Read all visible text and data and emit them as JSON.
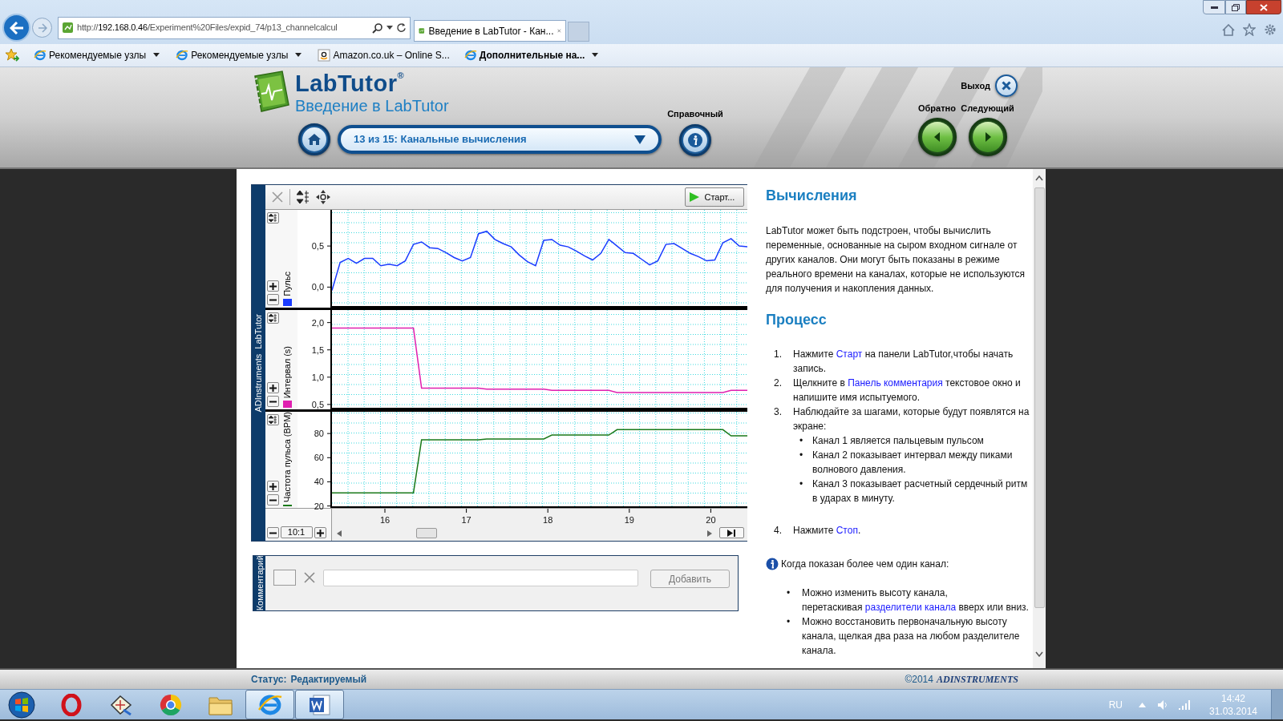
{
  "browser": {
    "address": {
      "scheme": "http://",
      "host": "192.168.0.46",
      "path": "/Experiment%20Files/expid_74/p13_channelcalcul"
    },
    "tab": "Введение в LabTutor - Кан...",
    "favorites": [
      {
        "kind": "ie",
        "label": "Рекомендуемые узлы",
        "emphasized": false,
        "menu": true
      },
      {
        "kind": "ie",
        "label": "Рекомендуемые узлы",
        "emphasized": false,
        "menu": true
      },
      {
        "kind": "amazon",
        "label": "Amazon.co.uk – Online S...",
        "emphasized": false,
        "menu": false
      },
      {
        "kind": "ie",
        "label": "Дополнительные на...",
        "emphasized": true,
        "menu": true
      }
    ]
  },
  "header": {
    "logo": "LabTutor$^{®}$",
    "subtitle": "Введение в LabTutor",
    "page_select": "13 из 15: Канальные вычисления",
    "help_label": "Справочный",
    "exit_label": "Выход",
    "back_label": "Обратно",
    "next_label": "Следующий"
  },
  "chart_panel": {
    "side_label": "ADInstruments  LabTutor",
    "start_button": "Старт...",
    "zoom_ratio": "10:1",
    "channels": [
      {
        "chart_data": {
          "type": "line",
          "grid": true,
          "ylabel": "Пульс",
          "categories": [
            null,
            null,
            null,
            null,
            null,
            null,
            null,
            null,
            null,
            null,
            null,
            null,
            null,
            null,
            null,
            null,
            null,
            null,
            null,
            null,
            null,
            null,
            null,
            null,
            null,
            null,
            null,
            null,
            null,
            null,
            null,
            null,
            null,
            null,
            null,
            null,
            null,
            null,
            null,
            null,
            null,
            null,
            null,
            null,
            null,
            null,
            null,
            null,
            null,
            null,
            null,
            null
          ],
          "series": [
            {
              "color": "#1a3cff",
              "values": [
                -0.04,
                0.3,
                0.35,
                0.29,
                0.35,
                0.35,
                0.26,
                0.28,
                0.26,
                0.32,
                0.52,
                0.55,
                0.48,
                0.47,
                0.42,
                0.36,
                0.32,
                0.36,
                0.65,
                0.68,
                0.58,
                0.53,
                0.49,
                0.39,
                0.31,
                0.26,
                0.57,
                0.58,
                0.51,
                0.49,
                0.44,
                0.38,
                0.33,
                0.41,
                0.58,
                0.5,
                0.42,
                0.41,
                0.34,
                0.27,
                0.32,
                0.52,
                0.53,
                0.47,
                0.41,
                0.37,
                0.32,
                0.33,
                0.54,
                0.59,
                0.5,
                0.49
              ]
            }
          ],
          "ylim": [
            -0.25,
            0.94
          ],
          "yticks": [
            {
              "value": 0,
              "label": "0,0"
            },
            {
              "value": 0.5,
              "label": "0,5"
            }
          ]
        }
      },
      {
        "chart_data": {
          "type": "line",
          "grid": true,
          "ylabel": "Интервал (s)",
          "categories": [
            null,
            null,
            null,
            null,
            null,
            null,
            null,
            null,
            null,
            null,
            null,
            null,
            null,
            null,
            null,
            null,
            null,
            null,
            null,
            null,
            null,
            null,
            null,
            null,
            null,
            null,
            null,
            null,
            null,
            null,
            null,
            null,
            null,
            null,
            null,
            null,
            null,
            null,
            null,
            null,
            null,
            null,
            null,
            null,
            null,
            null,
            null,
            null,
            null,
            null,
            null,
            null
          ],
          "series": [
            {
              "color": "#e020b0",
              "values": [
                1.9,
                1.9,
                1.9,
                1.9,
                1.9,
                1.9,
                1.9,
                1.9,
                1.9,
                1.9,
                1.9,
                0.8,
                0.8,
                0.8,
                0.8,
                0.8,
                0.8,
                0.8,
                0.8,
                0.78,
                0.78,
                0.78,
                0.78,
                0.78,
                0.78,
                0.78,
                0.78,
                0.76,
                0.76,
                0.76,
                0.76,
                0.76,
                0.76,
                0.76,
                0.76,
                0.72,
                0.72,
                0.72,
                0.72,
                0.72,
                0.72,
                0.72,
                0.72,
                0.72,
                0.72,
                0.72,
                0.72,
                0.72,
                0.72,
                0.76,
                0.76,
                0.76
              ]
            }
          ],
          "ylim": [
            0.41,
            2.23
          ],
          "yticks": [
            {
              "value": 0.5,
              "label": "0,5"
            },
            {
              "value": 1,
              "label": "1,0"
            },
            {
              "value": 1.5,
              "label": "1,5"
            },
            {
              "value": 2,
              "label": "2,0"
            }
          ]
        }
      },
      {
        "chart_data": {
          "type": "line",
          "grid": true,
          "ylabel": "Частота пульса (BPM)",
          "categories": [
            null,
            null,
            null,
            null,
            null,
            null,
            null,
            null,
            null,
            null,
            null,
            null,
            null,
            null,
            null,
            null,
            null,
            null,
            null,
            null,
            null,
            null,
            null,
            null,
            null,
            null,
            null,
            null,
            null,
            null,
            null,
            null,
            null,
            null,
            null,
            null,
            null,
            null,
            null,
            null,
            null,
            null,
            null,
            null,
            null,
            null,
            null,
            null,
            null,
            null,
            null,
            null
          ],
          "series": [
            {
              "color": "#1a7a1a",
              "values": [
                30.9,
                30.9,
                30.9,
                30.9,
                30.9,
                30.9,
                30.9,
                30.9,
                30.9,
                30.9,
                30.9,
                74.7,
                74.7,
                74.7,
                74.7,
                74.7,
                74.7,
                74.7,
                74.7,
                75.5,
                75.5,
                75.5,
                75.5,
                75.5,
                75.5,
                75.5,
                75.5,
                78.7,
                78.7,
                78.7,
                78.7,
                78.7,
                78.7,
                78.7,
                78.7,
                83.2,
                83.2,
                83.2,
                83.2,
                83.2,
                83.2,
                83.2,
                83.2,
                83.2,
                83.2,
                83.2,
                83.2,
                83.2,
                83.2,
                78.1,
                78.1,
                78.1
              ]
            }
          ],
          "ylim": [
            18.4,
            98
          ],
          "yticks": [
            {
              "value": 20,
              "label": "20"
            },
            {
              "value": 40,
              "label": "40"
            },
            {
              "value": 60,
              "label": "60"
            },
            {
              "value": 80,
              "label": "80"
            }
          ]
        }
      }
    ],
    "time_axis": [
      "16",
      "17",
      "18",
      "19",
      "20"
    ]
  },
  "comment_panel": {
    "side_label": "Комментарий",
    "add_button": "Добавить",
    "disabled": true
  },
  "article": {
    "heading_1": "Вычисления",
    "intro": "LabTutor может быть подстроен, чтобы вычислить переменные, основанные на сыром входном сигнале от других каналов. Они могут быть показаны в режиме реального времени на каналах, которые не используются для получения и накопления данных.",
    "heading_2": "Процесс",
    "steps": [
      {
        "number": "1.",
        "parts": [
          {
            "text": "Нажмите ",
            "link": false
          },
          {
            "text": "Старт",
            "link": true
          },
          {
            "text": " на панели LabTutor,чтобы начать запись.",
            "link": false
          }
        ]
      },
      {
        "number": "2.",
        "parts": [
          {
            "text": "Щелкните в ",
            "link": false
          },
          {
            "text": "Панель комментария",
            "link": true
          },
          {
            "text": " текстовое окно и напишите имя испытуемого.",
            "link": false
          }
        ]
      },
      {
        "number": "3.",
        "parts": [
          {
            "text": "Наблюдайте за шагами, которые будут появлятся на экране:",
            "link": false
          }
        ],
        "bullets": [
          {
            "marker": "•",
            "text": "Канал 1 является пальцевым пульсом"
          },
          {
            "marker": "•",
            "text": "Канал 2 показывает интервал между пиками волнового давления."
          },
          {
            "marker": "•",
            "text": "Канал 3 показывает расчетный сердечный ритм в ударах в минуту."
          }
        ]
      },
      {
        "number": "4.",
        "parts": [
          {
            "text": "Нажмите ",
            "link": false
          },
          {
            "text": "Стоп",
            "link": true
          },
          {
            "text": ".",
            "link": false
          }
        ]
      }
    ],
    "note": "Когда показан более чем один канал:",
    "note_bullets": [
      {
        "marker": "•",
        "lines": [
          [
            {
              "text": "Можно изменить высоту канала,",
              "link": false
            }
          ],
          [
            {
              "text": "перетаскивая ",
              "link": false
            },
            {
              "text": "разделители канала",
              "link": true
            },
            {
              "text": " вверх или вниз.",
              "link": false
            }
          ]
        ]
      },
      {
        "marker": "•",
        "lines": [
          [
            {
              "text": "Можно восстановить первоначальную  высоту канала, щелкая два раза на любом разделителе канала.",
              "link": false
            }
          ]
        ]
      }
    ]
  },
  "status_bar": {
    "label": "Статус:",
    "value": "Редактируемый",
    "copyright": "©2014",
    "brand": "ADINSTRUMENTS"
  },
  "taskbar": {
    "apps": [
      {
        "kind": "opera",
        "active": false
      },
      {
        "kind": "tool",
        "active": false
      },
      {
        "kind": "chrome",
        "active": false
      },
      {
        "kind": "folder",
        "active": false
      },
      {
        "kind": "ie",
        "active": true
      },
      {
        "kind": "word",
        "active": true
      }
    ],
    "language": "RU",
    "time": "14:42",
    "date": "31.03.2014"
  }
}
